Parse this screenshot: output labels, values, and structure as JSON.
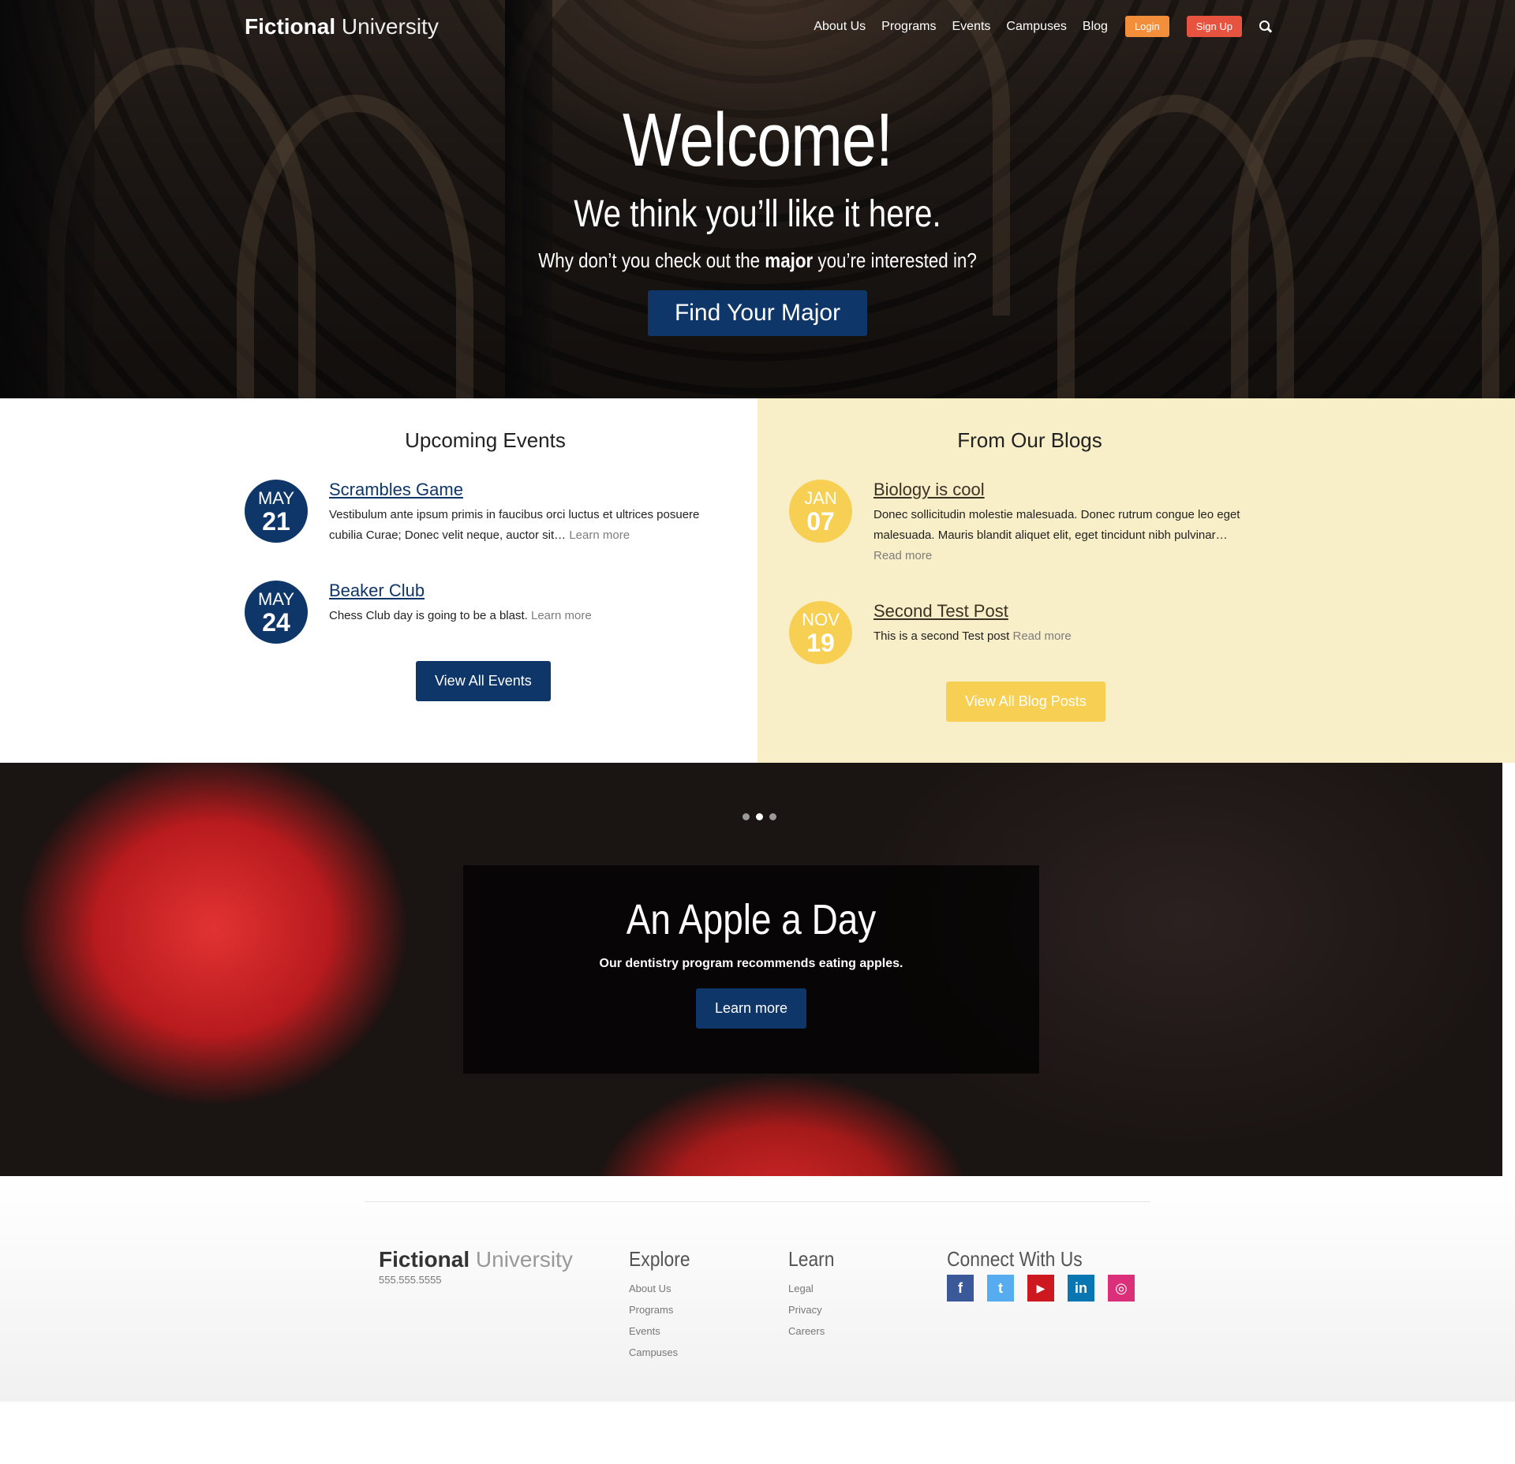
{
  "header": {
    "brand_bold": "Fictional",
    "brand_light": " University",
    "nav": [
      "About Us",
      "Programs",
      "Events",
      "Campuses",
      "Blog"
    ],
    "login_label": "Login",
    "signup_label": "Sign Up",
    "search_icon": "search-icon"
  },
  "hero": {
    "title": "Welcome!",
    "subtitle": "We think you’ll like it here.",
    "tagline_before": "Why don’t you check out the ",
    "tagline_bold": "major",
    "tagline_after": " you’re interested in?",
    "button_label": "Find Your Major"
  },
  "events": {
    "heading": "Upcoming Events",
    "items": [
      {
        "month": "MAY",
        "day": "21",
        "title": "Scrambles Game",
        "text": "Vestibulum ante ipsum primis in faucibus orci luctus et ultrices posuere cubilia Curae; Donec velit neque, auctor sit…",
        "more": "Learn more"
      },
      {
        "month": "MAY",
        "day": "24",
        "title": "Beaker Club",
        "text": "Chess Club day is going to be a blast.",
        "more": "Learn more"
      }
    ],
    "button_label": "View All Events"
  },
  "blogs": {
    "heading": "From Our Blogs",
    "items": [
      {
        "month": "JAN",
        "day": "07",
        "title": "Biology is cool",
        "text": "Donec sollicitudin molestie malesuada. Donec rutrum congue leo eget malesuada. Mauris blandit aliquet elit, eget tincidunt nibh pulvinar…",
        "more": "Read more"
      },
      {
        "month": "NOV",
        "day": "19",
        "title": "Second Test Post",
        "text": "This is a second Test post",
        "more": "Read more"
      }
    ],
    "button_label": "View All Blog Posts"
  },
  "slider": {
    "dots_count": 3,
    "active_dot": 2,
    "title": "An Apple a Day",
    "text": "Our dentistry program recommends eating apples.",
    "button_label": "Learn more"
  },
  "footer": {
    "brand_bold": "Fictional",
    "brand_light": " University",
    "phone": "555.555.5555",
    "explore": {
      "heading": "Explore",
      "links": [
        "About Us",
        "Programs",
        "Events",
        "Campuses"
      ]
    },
    "learn": {
      "heading": "Learn",
      "links": [
        "Legal",
        "Privacy",
        "Careers"
      ]
    },
    "connect": {
      "heading": "Connect With Us",
      "icons": [
        {
          "name": "facebook-icon",
          "glyph": "f",
          "color": "#3b5998"
        },
        {
          "name": "twitter-icon",
          "glyph": "t",
          "color": "#55acee"
        },
        {
          "name": "youtube-icon",
          "glyph": "▶",
          "color": "#cc181e"
        },
        {
          "name": "linkedin-icon",
          "glyph": "in",
          "color": "#0976b4"
        },
        {
          "name": "instagram-icon",
          "glyph": "◎",
          "color": "#dc2f79"
        }
      ]
    }
  },
  "colors": {
    "navy": "#0e3668",
    "gold": "#f7d053",
    "login": "#f38e3a",
    "signup": "#e8533f",
    "blog_bg": "#f8eec7"
  }
}
